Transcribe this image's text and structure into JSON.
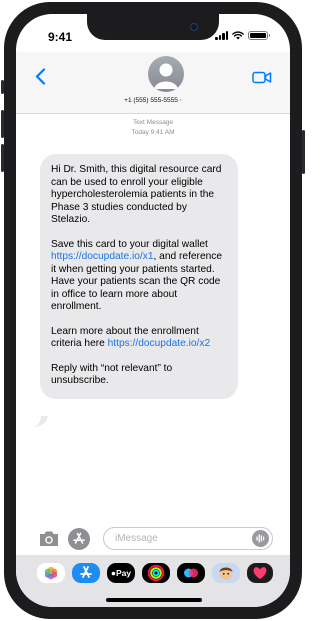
{
  "status_bar": {
    "time": "9:41"
  },
  "contact": {
    "phone_number": "+1 (555) 555-5555"
  },
  "thread": {
    "service_label": "Text Message",
    "timestamp": "Today 9:41 AM"
  },
  "message": {
    "paragraph_1": "Hi Dr. Smith, this digital resource card can be used to enroll your eligible hypercholesterolemia patients in the Phase 3 studies conducted by Stelazio.",
    "paragraph_2_before": "Save this card to your digital wallet ",
    "link_1": "https://docupdate.io/x1",
    "paragraph_2_after": ", and reference it when getting your patients started. Have your patients scan the QR code in office to learn more about enrollment.",
    "paragraph_3_before": "Learn more about the enrollment criteria here ",
    "link_2": "https://docupdate.io/x2",
    "paragraph_4": "Reply with “not relevant” to unsubscribe."
  },
  "composer": {
    "placeholder": "iMessage"
  },
  "app_drawer": {
    "apple_pay_label": "Pay",
    "items": [
      "photos",
      "app-store",
      "apple-pay",
      "activity",
      "digital-touch",
      "memoji",
      "heart"
    ]
  },
  "colors": {
    "link": "#1a73e8",
    "accent": "#007aff",
    "bubble": "#e9e9eb"
  }
}
